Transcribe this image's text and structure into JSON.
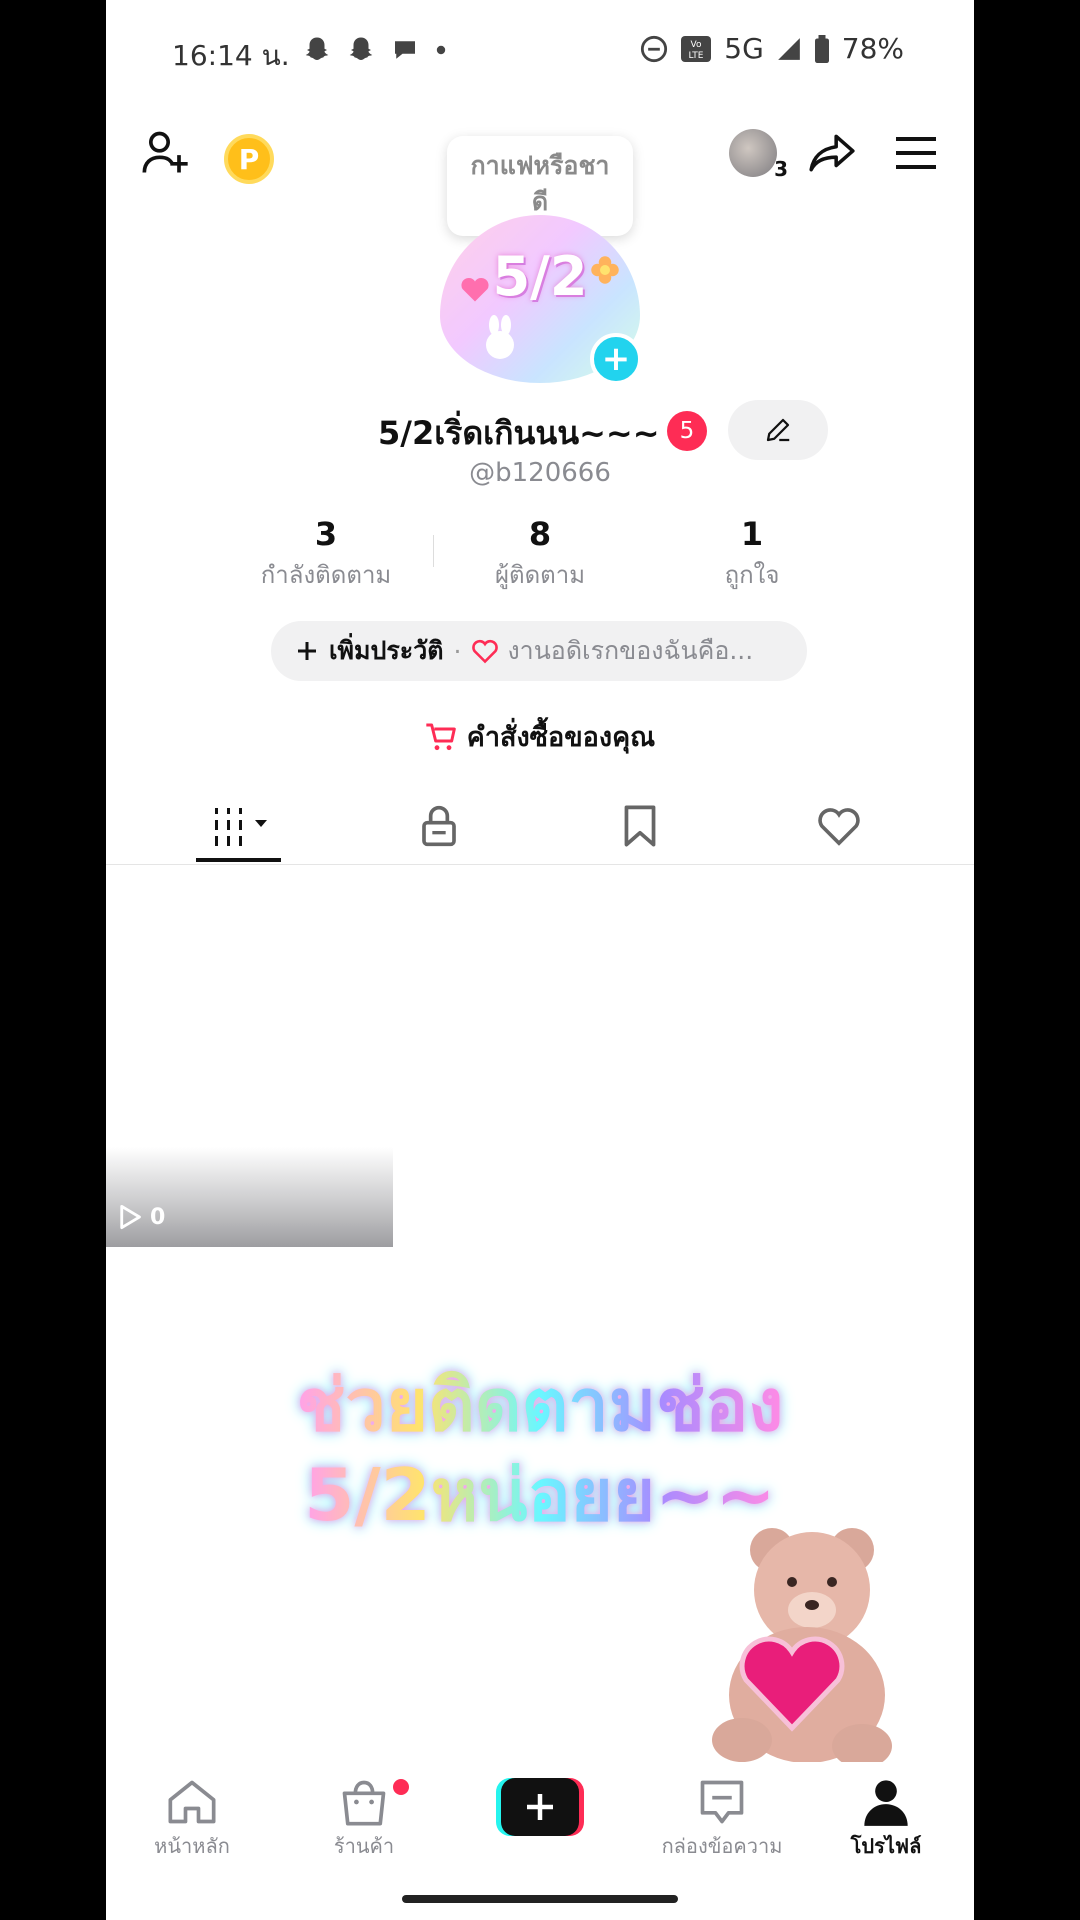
{
  "status_bar": {
    "time": "16:14 น.",
    "network": "5G",
    "battery": "78%",
    "icons": [
      "snapchat-icon",
      "snapchat-icon",
      "chat-bubble-icon",
      "dot-icon",
      "dnd-icon",
      "volte-icon",
      "signal-icon",
      "battery-icon"
    ]
  },
  "header": {
    "tooltip_text": "กาแฟหรือชา\nดี",
    "friends_count": "3"
  },
  "profile": {
    "avatar_text": "5/2",
    "display_name": "5/2เริ่ดเกินนน~~~",
    "notification_count": "5",
    "handle": "@b120666"
  },
  "stats": [
    {
      "value": "3",
      "label": "กำลังติดตาม"
    },
    {
      "value": "8",
      "label": "ผู้ติดตาม"
    },
    {
      "value": "1",
      "label": "ถูกใจ"
    }
  ],
  "bio": {
    "add_label": "เพิ่มประวัติ",
    "separator": "·",
    "text": "งานอดิเรกของฉันคือ..."
  },
  "orders_label": "คำสั่งซื้อของคุณ",
  "tabs": [
    "videos-grid-icon",
    "lock-icon",
    "bookmark-icon",
    "heart-icon"
  ],
  "video": {
    "views": "0"
  },
  "promo": {
    "line1": "ช่วยติดตามช่อง",
    "line2": "5/2หน่อยย~~"
  },
  "bottom_nav": [
    {
      "label": "หน้าหลัก",
      "icon": "home-icon"
    },
    {
      "label": "ร้านค้า",
      "icon": "shop-icon"
    },
    {
      "label": "",
      "icon": "create-icon"
    },
    {
      "label": "กล่องข้อความ",
      "icon": "inbox-icon"
    },
    {
      "label": "โปรไฟล์",
      "icon": "profile-icon"
    }
  ],
  "colors": {
    "accent": "#fe2c55",
    "cyan": "#22d3ee",
    "coin": "#ffbf1a"
  }
}
